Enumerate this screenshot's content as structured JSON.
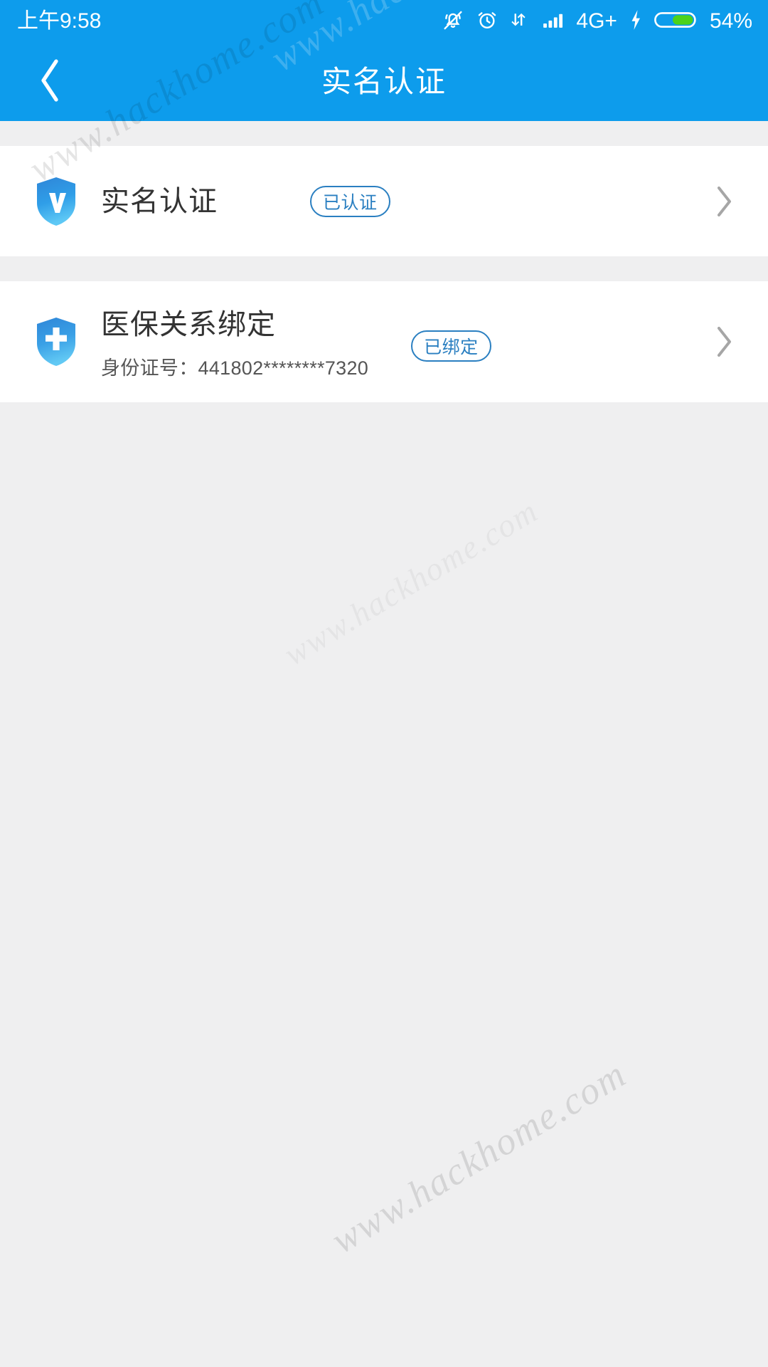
{
  "status_bar": {
    "time": "上午9:58",
    "network_label": "4G+",
    "battery_percent": "54%",
    "icons": [
      "bell-muted-icon",
      "alarm-clock-icon",
      "data-transfer-icon",
      "signal-bars-icon",
      "charging-bolt-icon",
      "battery-icon"
    ],
    "background_color": "#0d9cec",
    "text_color": "#ffffff",
    "battery_fill_color": "#4cd21a"
  },
  "app_bar": {
    "title": "实名认证",
    "back_icon": "chevron-left-icon",
    "background_color": "#0d9cec"
  },
  "page": {
    "background_color": "#efeff0"
  },
  "list": {
    "rows": [
      {
        "icon": "shield-verified-icon",
        "title": "实名认证",
        "badge": "已认证",
        "subtitle": "",
        "chevron": "chevron-right-icon"
      },
      {
        "icon": "shield-medical-cross-icon",
        "title": "医保关系绑定",
        "badge": "已绑定",
        "subtitle": "身份证号：441802********7320",
        "chevron": "chevron-right-icon"
      }
    ],
    "badge_color": "#2a7fc1",
    "title_color": "#333333",
    "subtitle_color": "#555555",
    "chevron_color": "#a6a6a6"
  },
  "watermarks": {
    "primary": "www.hackhome.com",
    "secondary": "www.hackhome.com",
    "tertiary": "www.hackhome.com",
    "quaternary": "www.hackhome.com"
  }
}
